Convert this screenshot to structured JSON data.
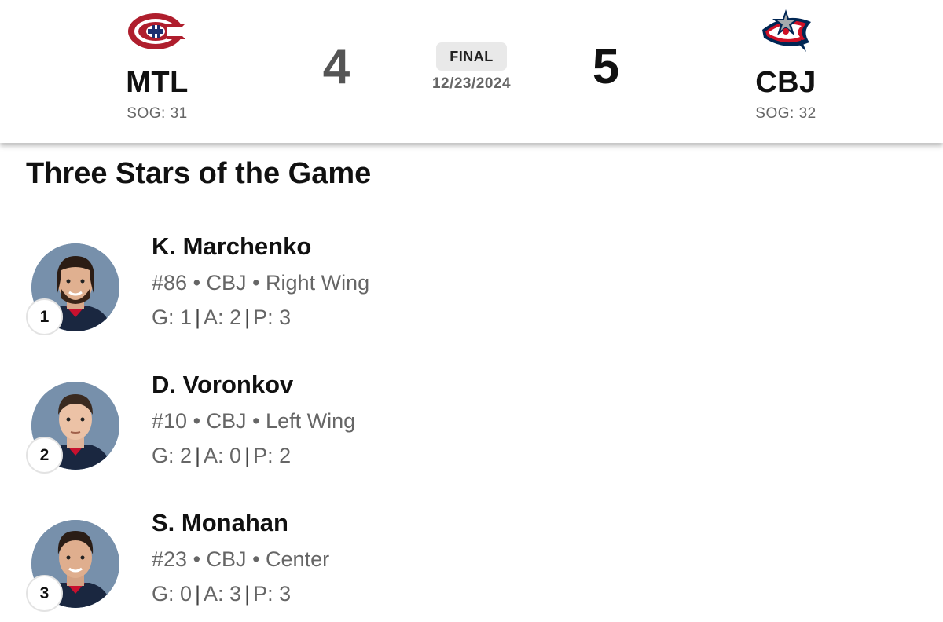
{
  "game": {
    "away": {
      "abbr": "MTL",
      "sog": "SOG: 31",
      "score": "4",
      "logo_icon": "canadiens-logo-icon",
      "color": "#af1e2d"
    },
    "home": {
      "abbr": "CBJ",
      "sog": "SOG: 32",
      "score": "5",
      "logo_icon": "blue-jackets-logo-icon",
      "color": "#002654"
    },
    "status": "FINAL",
    "date": "12/23/2024"
  },
  "section_title": "Three Stars of the Game",
  "stars": [
    {
      "rank": "1",
      "name": "K. Marchenko",
      "number": "#86",
      "team": "CBJ",
      "position": "Right Wing",
      "sep": "•",
      "g": "G: 1",
      "a": "A: 2",
      "p": "P: 3",
      "stat_sep": "|"
    },
    {
      "rank": "2",
      "name": "D. Voronkov",
      "number": "#10",
      "team": "CBJ",
      "position": "Left Wing",
      "sep": "•",
      "g": "G: 2",
      "a": "A: 0",
      "p": "P: 2",
      "stat_sep": "|"
    },
    {
      "rank": "3",
      "name": "S. Monahan",
      "number": "#23",
      "team": "CBJ",
      "position": "Center",
      "sep": "•",
      "g": "G: 0",
      "a": "A: 3",
      "p": "P: 3",
      "stat_sep": "|"
    }
  ]
}
